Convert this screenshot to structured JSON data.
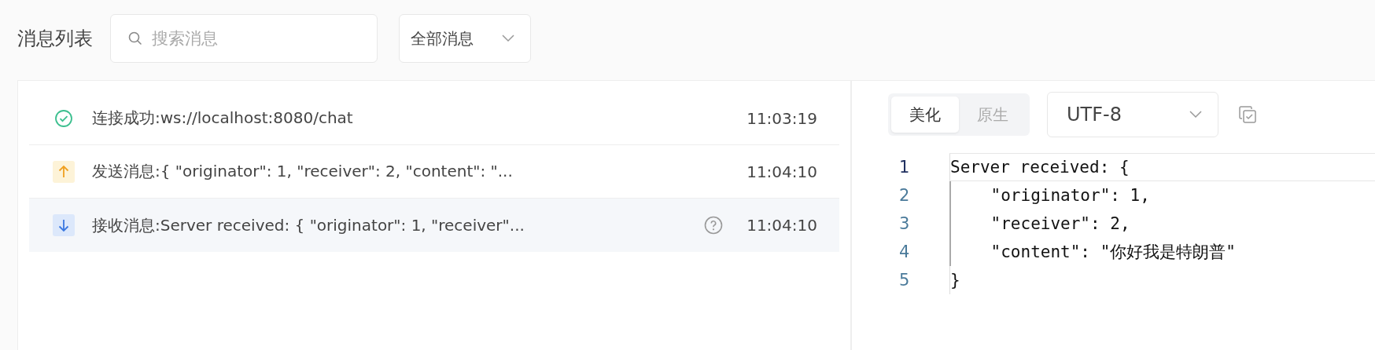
{
  "title": "消息列表",
  "search": {
    "placeholder": "搜索消息"
  },
  "filter": {
    "value": "全部消息"
  },
  "messages": [
    {
      "kind": "connected",
      "text": "连接成功:ws://localhost:8080/chat",
      "time": "11:03:19",
      "selected": false,
      "help": false
    },
    {
      "kind": "sent",
      "text": "发送消息:{ \"originator\": 1, \"receiver\": 2, \"content\": \"...",
      "time": "11:04:10",
      "selected": false,
      "help": false
    },
    {
      "kind": "received",
      "text": "接收消息:Server received: { \"originator\": 1, \"receiver\"...",
      "time": "11:04:10",
      "selected": true,
      "help": true
    }
  ],
  "view_tabs": [
    {
      "label": "美化",
      "selected": true
    },
    {
      "label": "原生",
      "selected": false
    }
  ],
  "encoding": {
    "value": "UTF-8"
  },
  "code": [
    {
      "number": "1",
      "text": "Server received: {",
      "active": true,
      "guide": false
    },
    {
      "number": "2",
      "text": "    \"originator\": 1,",
      "active": false,
      "guide": true
    },
    {
      "number": "3",
      "text": "    \"receiver\": 2,",
      "active": false,
      "guide": true
    },
    {
      "number": "4",
      "text": "    \"content\": \"你好我是特朗普\"",
      "active": false,
      "guide": true
    },
    {
      "number": "5",
      "text": "}",
      "active": false,
      "guide": false
    }
  ]
}
